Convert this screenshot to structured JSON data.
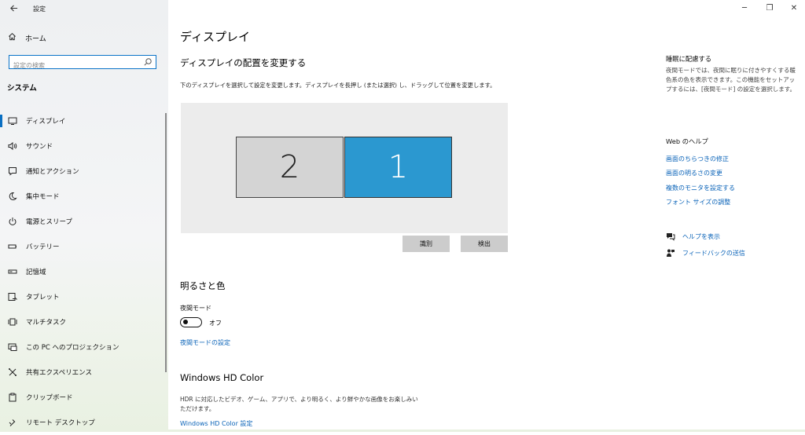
{
  "window": {
    "title": "設定",
    "back_icon": "arrow-left-icon",
    "minimize": "─",
    "restore": "❐",
    "close": "✕"
  },
  "sidebar": {
    "home_label": "ホーム",
    "search_placeholder": "設定の検索",
    "section_label": "システム",
    "items": [
      {
        "label": "ディスプレイ",
        "icon": "monitor-icon",
        "active": true
      },
      {
        "label": "サウンド",
        "icon": "speaker-icon"
      },
      {
        "label": "通知とアクション",
        "icon": "notification-icon"
      },
      {
        "label": "集中モード",
        "icon": "moon-icon"
      },
      {
        "label": "電源とスリープ",
        "icon": "power-icon"
      },
      {
        "label": "バッテリー",
        "icon": "battery-icon"
      },
      {
        "label": "記憶域",
        "icon": "storage-icon"
      },
      {
        "label": "タブレット",
        "icon": "tablet-icon"
      },
      {
        "label": "マルチタスク",
        "icon": "multitask-icon"
      },
      {
        "label": "この PC へのプロジェクション",
        "icon": "projection-icon"
      },
      {
        "label": "共有エクスペリエンス",
        "icon": "shared-experience-icon"
      },
      {
        "label": "クリップボード",
        "icon": "clipboard-icon"
      },
      {
        "label": "リモート デスクトップ",
        "icon": "remote-desktop-icon"
      }
    ]
  },
  "main": {
    "title": "ディスプレイ",
    "arrange_heading": "ディスプレイの配置を変更する",
    "arrange_desc": "下のディスプレイを選択して設定を変更します。ディスプレイを長押し (または選択) し、ドラッグして位置を変更します。",
    "monitor_2": "2",
    "monitor_1": "1",
    "identify_button": "識別",
    "detect_button": "検出",
    "brightness_heading": "明るさと色",
    "night_mode_label": "夜間モード",
    "night_mode_state": "オフ",
    "night_mode_link": "夜間モードの設定",
    "hdr_heading": "Windows HD Color",
    "hdr_desc": "HDR に対応したビデオ、ゲーム、アプリで、より明るく、より鮮やかな画像をお楽しみいただけます。",
    "hdr_link": "Windows HD Color 設定"
  },
  "right": {
    "sleep_title": "睡眠に配慮する",
    "sleep_text": "夜間モードでは、夜間に眠りに付きやすくする暖色系の色を表示できます。この機能をセットアップするには、[夜間モード] の設定を選択します。",
    "help_title": "Web のヘルプ",
    "help_links": [
      "画面のちらつきの修正",
      "画面の明るさの変更",
      "複数のモニタを設定する",
      "フォント サイズの調整"
    ],
    "show_help": "ヘルプを表示",
    "feedback": "フィードバックの送信"
  }
}
